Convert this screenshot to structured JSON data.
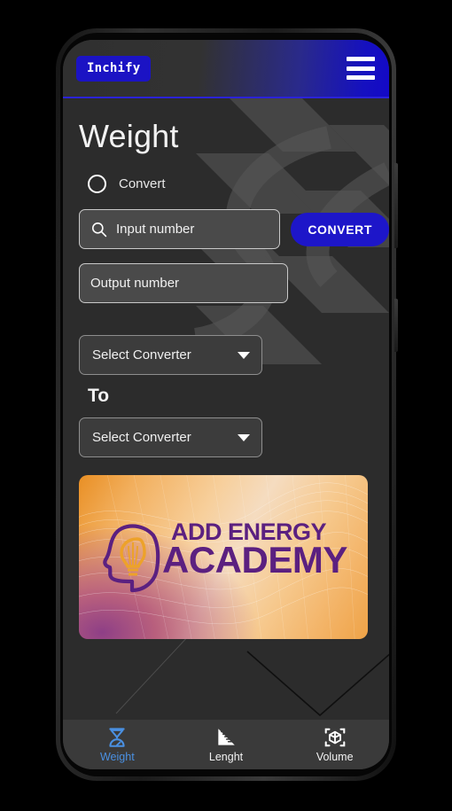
{
  "app": {
    "brand": "Inchify",
    "menu_icon": "hamburger-menu-icon"
  },
  "page": {
    "title": "Weight"
  },
  "mode": {
    "radio_label": "Convert",
    "selected": false
  },
  "form": {
    "input_placeholder": "Input number",
    "input_value": "",
    "search_icon": "search-icon",
    "convert_button": "CONVERT",
    "output_placeholder": "Output number",
    "output_value": "",
    "from_select": {
      "label": "Select Converter",
      "caret": "chevron-down-icon"
    },
    "to_separator": "To",
    "to_select": {
      "label": "Select Converter",
      "caret": "chevron-down-icon"
    }
  },
  "ad": {
    "line1": "ADD ENERGY",
    "line2": "ACADEMY",
    "logo_icon": "head-lightbulb-icon"
  },
  "bottom_nav": {
    "items": [
      {
        "label": "Weight",
        "icon": "scale-icon",
        "active": true
      },
      {
        "label": "Lenght",
        "icon": "ruler-triangle-icon",
        "active": false
      },
      {
        "label": "Volume",
        "icon": "cube-scan-icon",
        "active": false
      }
    ]
  },
  "colors": {
    "brand_blue": "#1b13c4",
    "accent_blue": "#1d16c9",
    "active_nav": "#4a90e2",
    "screen_bg": "#2c2c2c",
    "nav_bg": "#3a3a3a",
    "ad_purple": "#5b2080",
    "ad_orange": "#e98f24"
  }
}
